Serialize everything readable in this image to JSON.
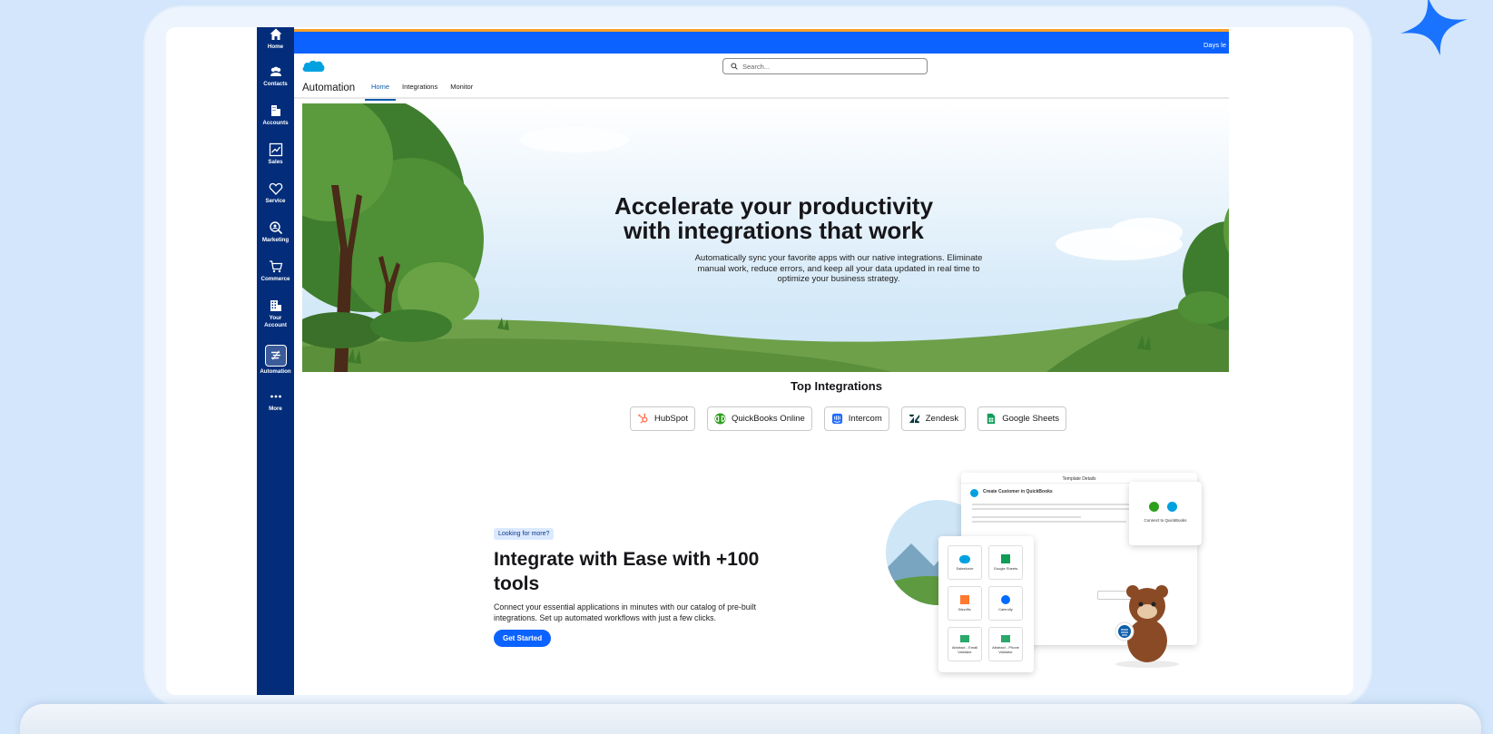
{
  "sidebar": {
    "items": [
      {
        "label": "Home",
        "icon": "home-icon"
      },
      {
        "label": "Contacts",
        "icon": "contacts-icon"
      },
      {
        "label": "Accounts",
        "icon": "building-icon"
      },
      {
        "label": "Sales",
        "icon": "chart-icon"
      },
      {
        "label": "Service",
        "icon": "heart-icon"
      },
      {
        "label": "Marketing",
        "icon": "magnify-icon"
      },
      {
        "label": "Commerce",
        "icon": "cart-icon"
      },
      {
        "label": "Your Account",
        "icon": "grid-building-icon"
      },
      {
        "label": "Automation",
        "icon": "automation-icon",
        "active": true
      },
      {
        "label": "More",
        "icon": "more-icon"
      }
    ]
  },
  "topbar": {
    "days_left": "Days le"
  },
  "header": {
    "search_placeholder": "Search...",
    "app_name": "Automation",
    "tabs": [
      {
        "label": "Home",
        "active": true
      },
      {
        "label": "Integrations"
      },
      {
        "label": "Monitor"
      }
    ]
  },
  "hero": {
    "title_line1": "Accelerate your productivity",
    "title_line2": "with integrations that work",
    "subtitle": "Automatically sync your favorite apps with our native integrations. Eliminate manual work, reduce errors, and keep all your data updated in real time to optimize your business strategy."
  },
  "top_integrations": {
    "title": "Top Integrations",
    "items": [
      {
        "label": "HubSpot",
        "color": "#ff7a59"
      },
      {
        "label": "QuickBooks Online",
        "color": "#2ca01c"
      },
      {
        "label": "Intercom",
        "color": "#1f6bff"
      },
      {
        "label": "Zendesk",
        "color": "#03363d"
      },
      {
        "label": "Google Sheets",
        "color": "#0f9d58"
      }
    ]
  },
  "promo": {
    "badge": "Looking for more?",
    "title": "Integrate with Ease with +100 tools",
    "text": "Connect your essential applications in minutes with our catalog of pre-built integrations. Set up automated workflows with just a few clicks.",
    "button": "Get Started"
  },
  "illustration": {
    "template_header": "Template Details",
    "template_title": "Create Customer in QuickBooks",
    "connect_label": "Connect to QuickBooks",
    "tiles": [
      "Salesforce",
      "Google Sheets",
      "Bizzrific",
      "Calendly",
      "Abstract - Email Validator",
      "Abstract - Phone Validator"
    ]
  },
  "colors": {
    "brand_blue": "#0b62ff",
    "sidebar_navy": "#032d7a",
    "page_bg": "#d3e6fb"
  }
}
